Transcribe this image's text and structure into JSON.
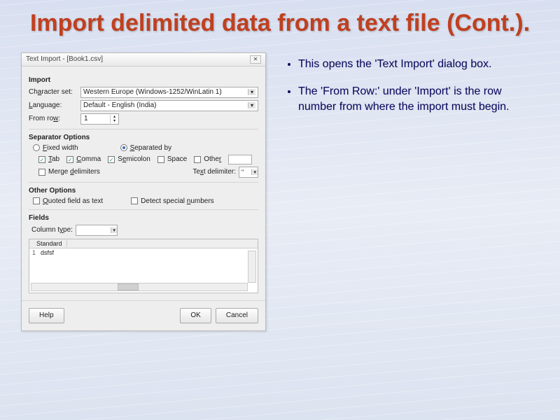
{
  "slide": {
    "title": "Import delimited data from a text file (Cont.)."
  },
  "bullets": [
    "This opens the 'Text Import' dialog box.",
    "The 'From Row:' under 'Import' is the row number from where the import must begin."
  ],
  "dialog": {
    "title": "Text Import - [Book1.csv]",
    "sections": {
      "import": "Import",
      "separator": "Separator Options",
      "other": "Other Options",
      "fields": "Fields"
    },
    "labels": {
      "charset": "Character set:",
      "language": "Language:",
      "fromrow": "From row:",
      "fixed": "Fixed width",
      "separated": "Separated by",
      "tab": "Tab",
      "comma": "Comma",
      "semicolon": "Semicolon",
      "space": "Space",
      "other": "Other",
      "merge": "Merge delimiters",
      "textdelim": "Text delimiter:",
      "quoted": "Quoted field as text",
      "detect": "Detect special numbers",
      "coltype": "Column type:"
    },
    "values": {
      "charset": "Western Europe (Windows-1252/WinLatin 1)",
      "language": "Default - English (India)",
      "fromrow": "1",
      "textdelim": "\"",
      "field_header": "Standard",
      "field_row1": "dsfsf"
    },
    "buttons": {
      "help": "Help",
      "ok": "OK",
      "cancel": "Cancel"
    }
  }
}
